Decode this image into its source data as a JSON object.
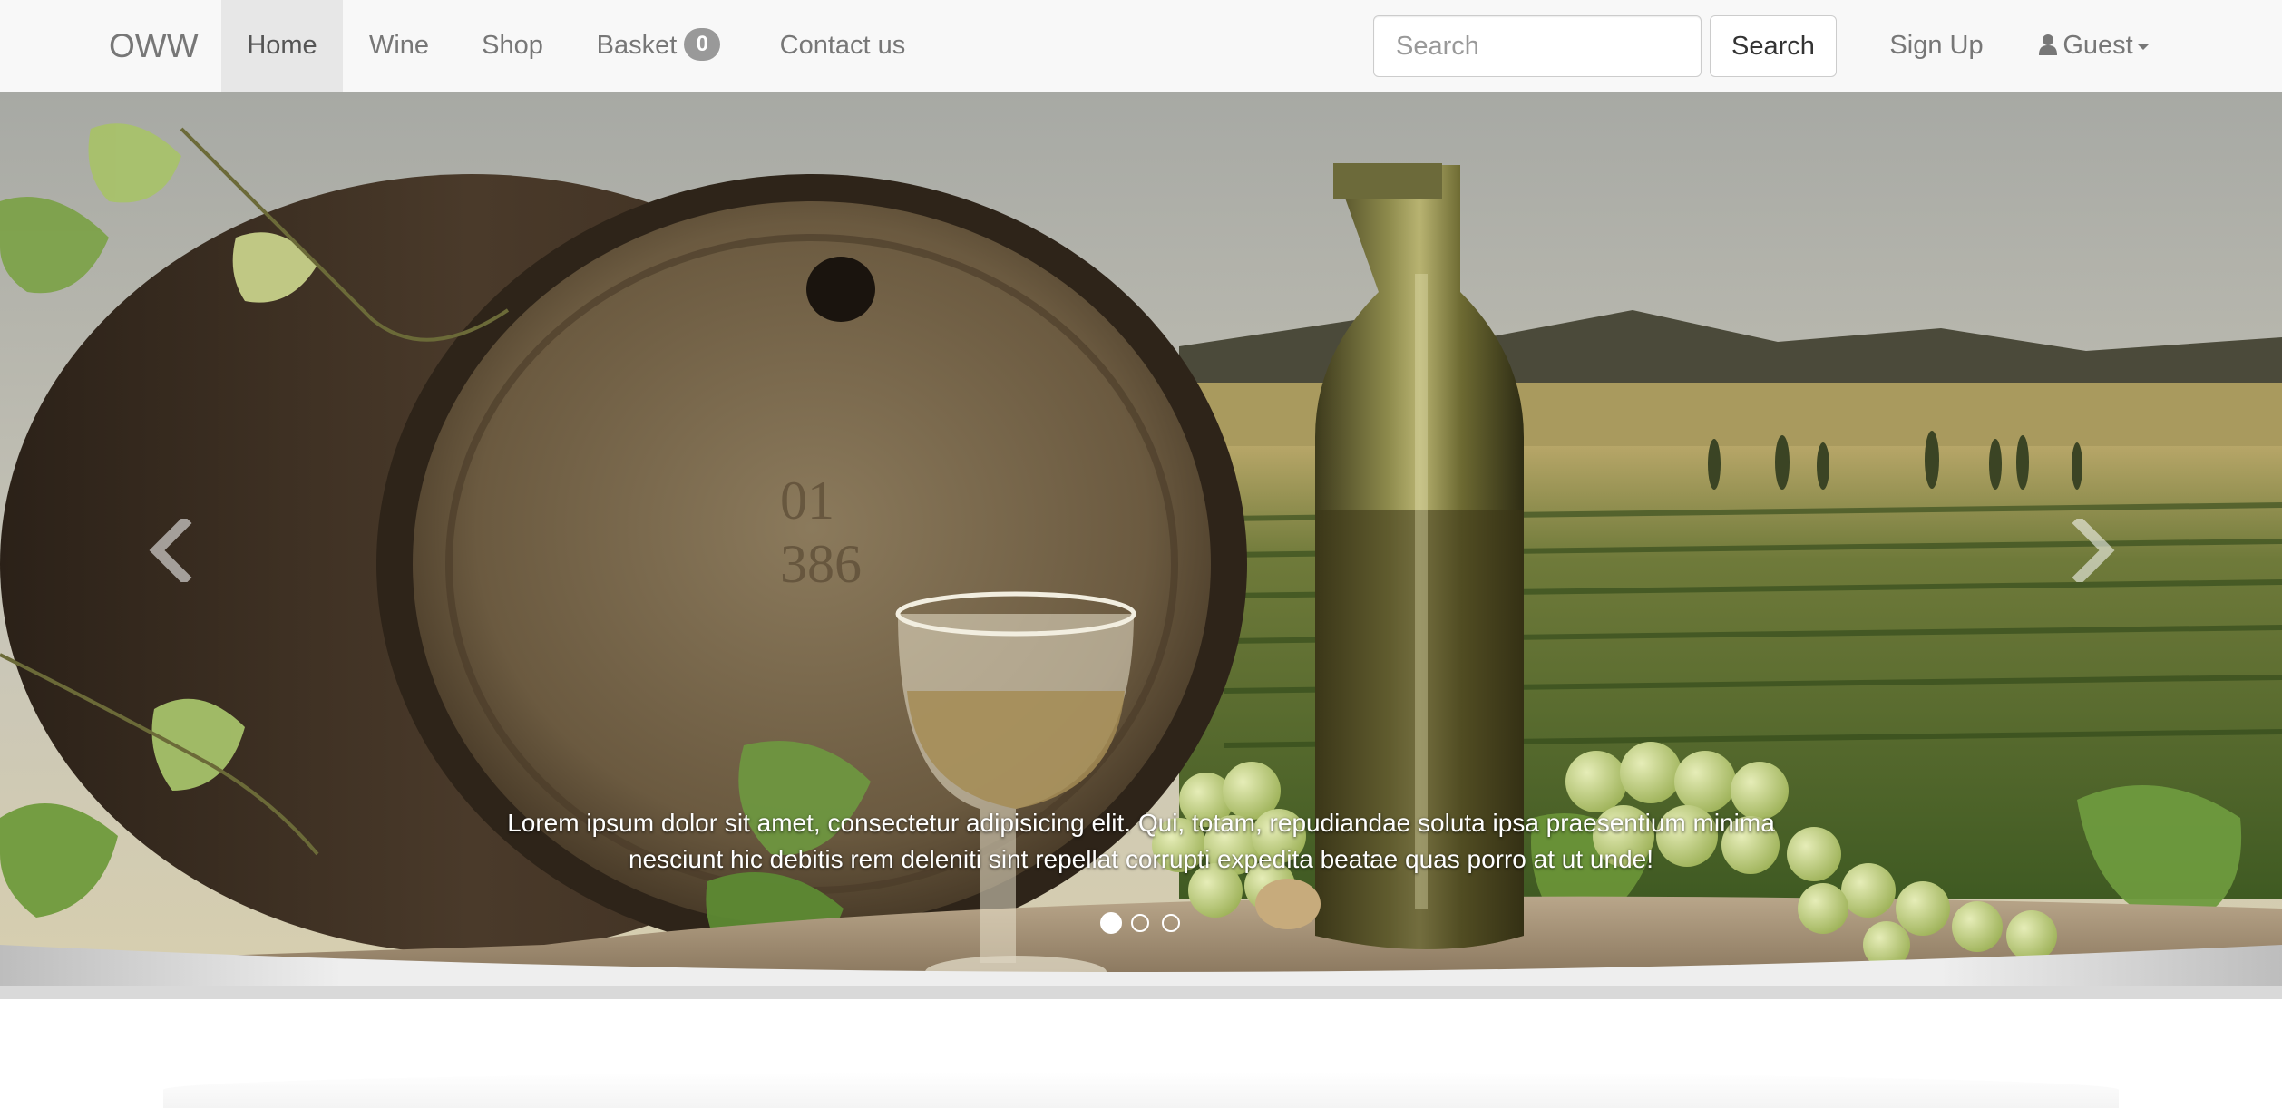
{
  "nav": {
    "brand": "OWW",
    "items": [
      {
        "label": "Home",
        "active": true
      },
      {
        "label": "Wine",
        "active": false
      },
      {
        "label": "Shop",
        "active": false
      },
      {
        "label": "Basket",
        "active": false,
        "badge": "0"
      },
      {
        "label": "Contact us",
        "active": false
      }
    ],
    "search": {
      "placeholder": "Search",
      "value": "",
      "button_label": "Search"
    },
    "signup_label": "Sign Up",
    "user_label": "Guest"
  },
  "carousel": {
    "caption": "Lorem ipsum dolor sit amet, consectetur adipisicing elit. Qui, totam, repudiandae soluta ipsa praesentium minima nesciunt hic debitis rem deleniti sint repellat corrupti expedita beatae quas porro at ut unde!",
    "slide_count": 3,
    "active_slide": 1,
    "prev_icon": "chevron-left-icon",
    "next_icon": "chevron-right-icon"
  },
  "colors": {
    "navbar_bg": "#f8f8f8",
    "nav_active_bg": "#e7e7e7",
    "nav_text": "#777777",
    "badge_bg": "#999999"
  }
}
